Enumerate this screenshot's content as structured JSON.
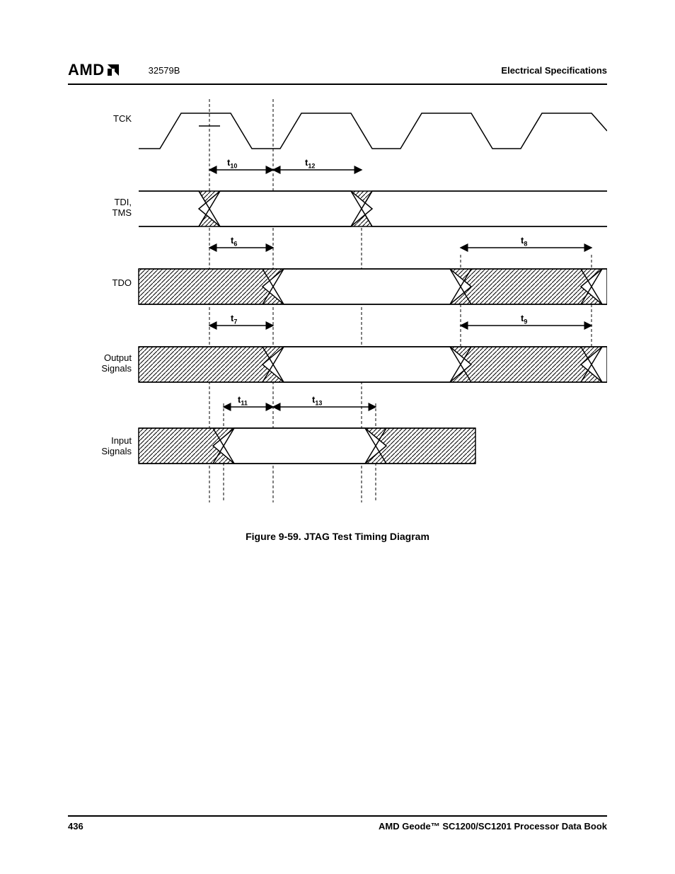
{
  "header": {
    "logo_text": "AMD",
    "doc_number": "32579B",
    "section": "Electrical Specifications"
  },
  "figure": {
    "caption": "Figure 9-59.  JTAG Test Timing Diagram",
    "signals": {
      "tck": "TCK",
      "tdi_tms": "TDI,\nTMS",
      "tdo": "TDO",
      "output": "Output\nSignals",
      "input": "Input\nSignals"
    },
    "timing_labels": {
      "t6": "t6",
      "t7": "t7",
      "t8": "t8",
      "t9": "t9",
      "t10": "t10",
      "t11": "t11",
      "t12": "t12",
      "t13": "t13"
    }
  },
  "footer": {
    "page_number": "436",
    "book_title": "AMD Geode™ SC1200/SC1201 Processor Data Book"
  }
}
